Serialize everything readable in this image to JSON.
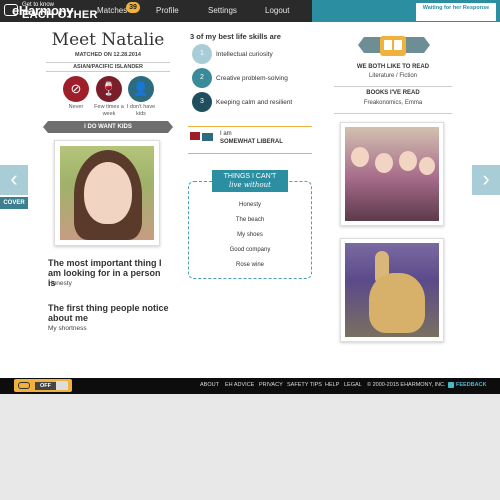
{
  "header": {
    "logo": "eHarmony",
    "nav": [
      "Matches",
      "Profile",
      "Settings",
      "Logout"
    ],
    "matches_badge": "39",
    "etk_small": "Get to know",
    "etk_big": "EACH OTHER",
    "waiting": "Waiting for her Response"
  },
  "profile": {
    "name": "Meet Natalie",
    "matched": "MATCHED ON 12.28.2014",
    "ethnicity": "ASIAN/PACIFIC ISLANDER",
    "smoke": "Never",
    "drink": "Few times a week",
    "kids": "I don't have kids",
    "want_kids": "I DO WANT KIDS",
    "q1_title": "The most important thing I am looking for in a person is",
    "q1_answer": "Honesty",
    "q2_title": "The first thing people notice about me",
    "q2_answer": "My shortness"
  },
  "skills": {
    "title": "3 of my best life skills are",
    "items": [
      {
        "n": "1",
        "label": "Intellectual curiosity"
      },
      {
        "n": "2",
        "label": "Creative problem-solving"
      },
      {
        "n": "3",
        "label": "Keeping calm and resilient"
      }
    ]
  },
  "political": {
    "line1": "I am",
    "line2": "SOMEWHAT LIBERAL"
  },
  "things": {
    "banner1": "THINGS I CAN'T",
    "banner2": "live without",
    "items": [
      "Honesty",
      "The beach",
      "My shoes",
      "Good company",
      "Rose wine"
    ]
  },
  "books": {
    "both_title": "WE BOTH LIKE TO READ",
    "both_value": "Literature / Fiction",
    "read_title": "BOOKS I'VE READ",
    "read_value": "Freakonomics, Emma"
  },
  "nav_side": {
    "cover": "COVER"
  },
  "footer": {
    "toggle": "OFF",
    "links": [
      "ABOUT",
      "EH ADVICE",
      "PRIVACY",
      "SAFETY TIPS",
      "HELP",
      "LEGAL",
      "© 2000-2015 EHARMONY, INC."
    ],
    "feedback": "FEEDBACK"
  },
  "colors": {
    "teal": "#2b8ea1",
    "orange": "#f0b23d",
    "dark": "#2a2a2a"
  }
}
